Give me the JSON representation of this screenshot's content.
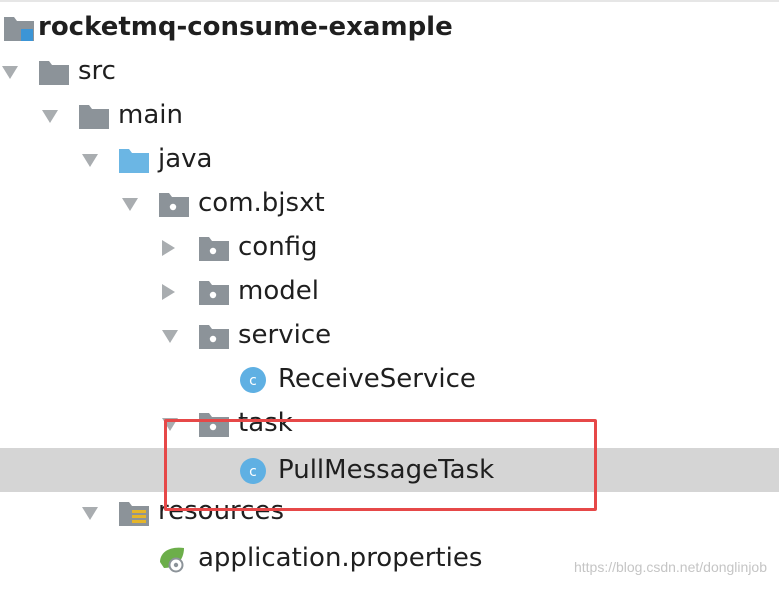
{
  "project_tree": {
    "root": {
      "label": "rocketmq-consume-example",
      "icon": "module-folder-icon"
    },
    "src": {
      "label": "src",
      "icon": "folder-icon"
    },
    "main": {
      "label": "main",
      "icon": "folder-icon"
    },
    "java": {
      "label": "java",
      "icon": "source-root-folder-icon",
      "color": "#6bb6e4"
    },
    "package": {
      "label": "com.bjsxt",
      "icon": "package-folder-icon"
    },
    "config": {
      "label": "config",
      "icon": "package-folder-icon"
    },
    "model": {
      "label": "model",
      "icon": "package-folder-icon"
    },
    "service": {
      "label": "service",
      "icon": "package-folder-icon"
    },
    "receive_service": {
      "label": "ReceiveService",
      "icon": "java-class-icon",
      "color": "#5fb0e3"
    },
    "task": {
      "label": "task",
      "icon": "package-folder-icon"
    },
    "pull_message_task": {
      "label": "PullMessageTask",
      "icon": "java-class-icon",
      "selected": true
    },
    "resources": {
      "label": "resources",
      "icon": "resources-folder-icon"
    },
    "application_properties": {
      "label": "application.properties",
      "icon": "spring-properties-icon",
      "color": "#6cae4a"
    }
  },
  "colors": {
    "selection": "#d5d5d5",
    "highlight_box": "#e64848",
    "folder_gray": "#8c9399",
    "arrow_gray": "#a9adb0"
  },
  "watermark": "https://blog.csdn.net/donglinjob"
}
